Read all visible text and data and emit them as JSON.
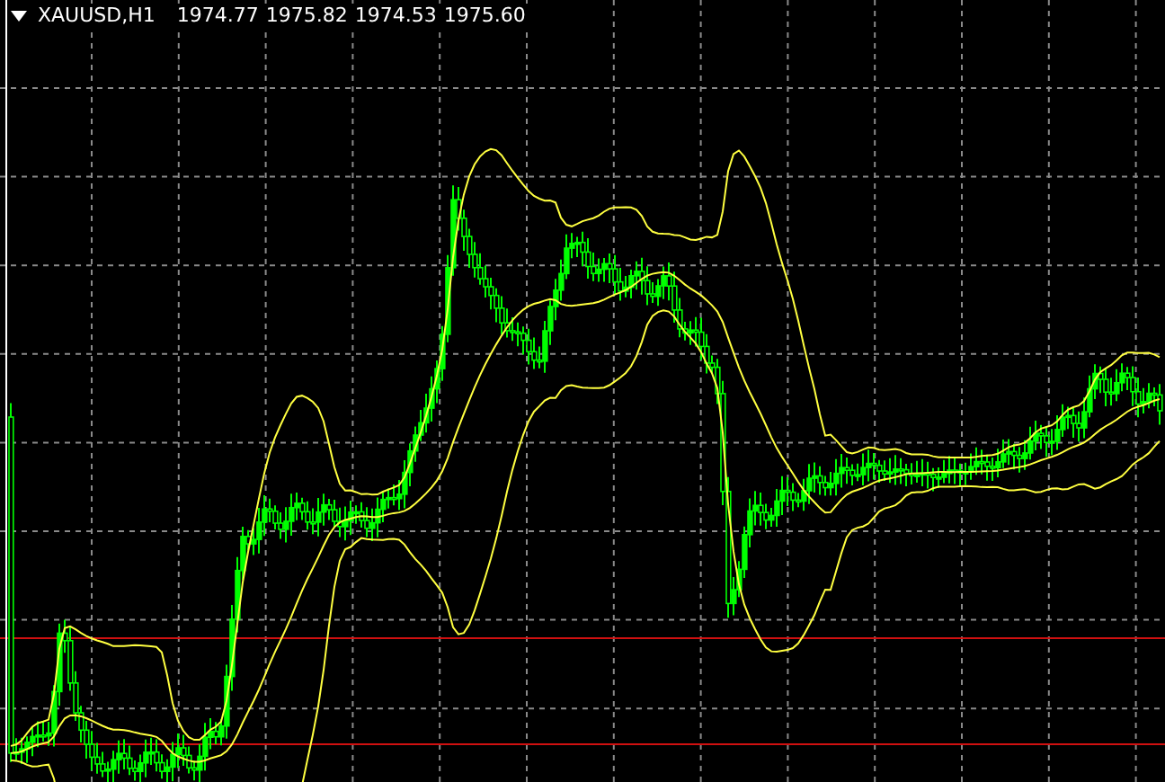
{
  "chart": {
    "symbol": "XAUUSD,H1",
    "values": [
      "1974.77",
      "1975.82",
      "1974.53",
      "1975.60"
    ]
  }
}
